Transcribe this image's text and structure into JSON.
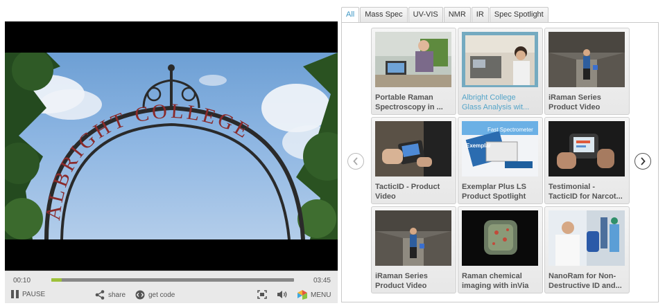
{
  "player": {
    "time_current": "00:10",
    "time_duration": "03:45",
    "progress": 0.044,
    "pause_label": "PAUSE",
    "share_label": "share",
    "getcode_label": "get code",
    "menu_label": "MENU"
  },
  "tabs": [
    {
      "label": "All",
      "active": true
    },
    {
      "label": "Mass Spec",
      "active": false
    },
    {
      "label": "UV-VIS",
      "active": false
    },
    {
      "label": "NMR",
      "active": false
    },
    {
      "label": "IR",
      "active": false
    },
    {
      "label": "Spec Spotlight",
      "active": false
    }
  ],
  "videos": [
    {
      "title": "Portable Raman\nSpectroscopy in ...",
      "active": false
    },
    {
      "title": "Albright College\nGlass Analysis wit...",
      "active": true
    },
    {
      "title": "iRaman Series\nProduct Video",
      "active": false
    },
    {
      "title": "TacticID - Product\nVideo",
      "active": false
    },
    {
      "title": "Exemplar Plus LS\nProduct Spotlight",
      "active": false
    },
    {
      "title": "Testimonial -\nTacticID for Narcot...",
      "active": false
    },
    {
      "title": "iRaman Series\nProduct Video",
      "active": false
    },
    {
      "title": "Raman chemical\nimaging with inVia",
      "active": false
    },
    {
      "title": "NanoRam for Non-\nDestructive ID and...",
      "active": false
    }
  ],
  "thumb_text": {
    "exemplar_device": "Fast Spectrometer",
    "exemplar_brand": "Exemplar"
  },
  "frame_text": "ALBRIGHT COLLEGE",
  "colors": {
    "accent": "#3e97c4",
    "progress": "#9dc13a"
  }
}
